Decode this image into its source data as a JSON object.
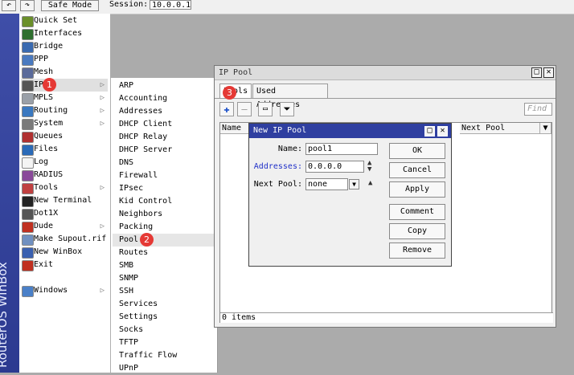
{
  "toolbar": {
    "safe_mode_label": "Safe Mode",
    "session_label": "Session:",
    "session_value": "10.0.0.1"
  },
  "brand": {
    "text": "RouterOS WinBox"
  },
  "left_menu": [
    {
      "label": "Quick Set",
      "icon": "quick-set-icon",
      "color": "#6a8f2a",
      "arrow": false
    },
    {
      "label": "Interfaces",
      "icon": "interfaces-icon",
      "color": "#2f6f2f",
      "arrow": false
    },
    {
      "label": "Bridge",
      "icon": "bridge-icon",
      "color": "#3a6ab0",
      "arrow": false
    },
    {
      "label": "PPP",
      "icon": "ppp-icon",
      "color": "#4a7ac0",
      "arrow": false
    },
    {
      "label": "Mesh",
      "icon": "mesh-icon",
      "color": "#5a6a9a",
      "arrow": false
    },
    {
      "label": "IP",
      "icon": "ip-icon",
      "color": "#555555",
      "arrow": true
    },
    {
      "label": "MPLS",
      "icon": "mpls-icon",
      "color": "#9aa0a8",
      "arrow": true
    },
    {
      "label": "Routing",
      "icon": "routing-icon",
      "color": "#3a78c0",
      "arrow": true
    },
    {
      "label": "System",
      "icon": "system-icon",
      "color": "#7a7a7a",
      "arrow": true
    },
    {
      "label": "Queues",
      "icon": "queues-icon",
      "color": "#b03030",
      "arrow": false
    },
    {
      "label": "Files",
      "icon": "files-icon",
      "color": "#2a6ab8",
      "arrow": false
    },
    {
      "label": "Log",
      "icon": "log-icon",
      "color": "#f4f4f4",
      "arrow": false
    },
    {
      "label": "RADIUS",
      "icon": "radius-icon",
      "color": "#8a4a9a",
      "arrow": false
    },
    {
      "label": "Tools",
      "icon": "tools-icon",
      "color": "#c04040",
      "arrow": true
    },
    {
      "label": "New Terminal",
      "icon": "terminal-icon",
      "color": "#222222",
      "arrow": false
    },
    {
      "label": "Dot1X",
      "icon": "dot1x-icon",
      "color": "#555555",
      "arrow": false
    },
    {
      "label": "Dude",
      "icon": "dude-icon",
      "color": "#c03020",
      "arrow": true
    },
    {
      "label": "Make Supout.rif",
      "icon": "supout-icon",
      "color": "#7090c0",
      "arrow": false
    },
    {
      "label": "New WinBox",
      "icon": "winbox-icon",
      "color": "#3a60b0",
      "arrow": false
    },
    {
      "label": "Exit",
      "icon": "exit-icon",
      "color": "#c03020",
      "arrow": false
    },
    {
      "label": "Windows",
      "icon": "windows-icon",
      "color": "#4a80c8",
      "arrow": true
    }
  ],
  "ip_submenu": [
    "ARP",
    "Accounting",
    "Addresses",
    "DHCP Client",
    "DHCP Relay",
    "DHCP Server",
    "DNS",
    "Firewall",
    "IPsec",
    "Kid Control",
    "Neighbors",
    "Packing",
    "Pool",
    "Routes",
    "SMB",
    "SNMP",
    "SSH",
    "Services",
    "Settings",
    "Socks",
    "TFTP",
    "Traffic Flow",
    "UPnP"
  ],
  "badges": [
    "1",
    "2",
    "3"
  ],
  "pool_window": {
    "title": "IP Pool",
    "tabs": [
      "Pools",
      "Used Addresses"
    ],
    "find_placeholder": "Find",
    "columns": [
      "Name",
      "Next Pool"
    ],
    "status": "0 items"
  },
  "dialog": {
    "title": "New IP Pool",
    "name_label": "Name:",
    "name_value": "pool1",
    "addresses_label": "Addresses:",
    "addresses_value": "0.0.0.0",
    "next_pool_label": "Next Pool:",
    "next_pool_value": "none",
    "buttons": [
      "OK",
      "Cancel",
      "Apply",
      "Comment",
      "Copy",
      "Remove"
    ]
  },
  "colors": {
    "brand_bg": "#2c3a90",
    "dialog_title_bg": "#2f3fa0",
    "badge": "#e53935",
    "addresses_label": "#2030c8",
    "add_icon": "#1a4fc8"
  }
}
